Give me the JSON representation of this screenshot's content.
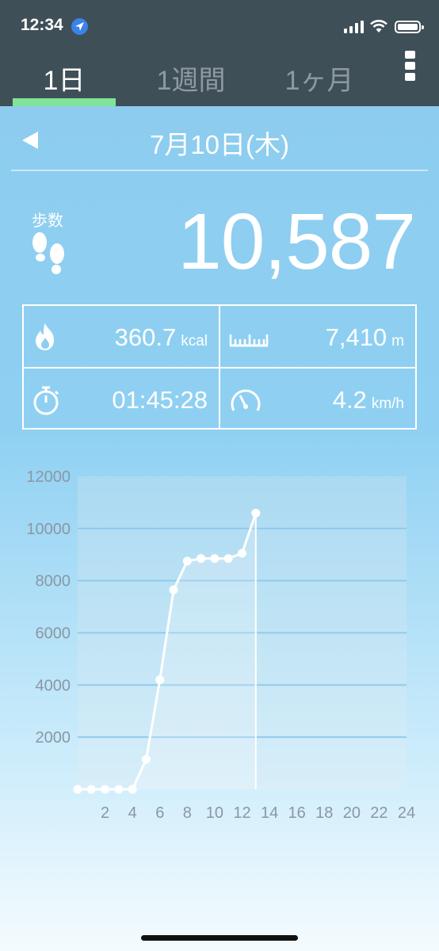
{
  "status_bar": {
    "time": "12:34"
  },
  "tabs": [
    {
      "label": "1日",
      "active": true
    },
    {
      "label": "1週間",
      "active": false
    },
    {
      "label": "1ヶ月",
      "active": false
    }
  ],
  "date": {
    "label": "7月10日(木)"
  },
  "steps": {
    "label": "歩数",
    "value": "10,587"
  },
  "stats": {
    "calories": {
      "value": "360.7",
      "unit": "kcal",
      "icon": "flame-icon"
    },
    "distance": {
      "value": "7,410",
      "unit": "m",
      "icon": "ruler-icon"
    },
    "duration": {
      "value": "01:45:28",
      "icon": "stopwatch-icon"
    },
    "speed": {
      "value": "4.2",
      "unit": "km/h",
      "icon": "speedometer-icon"
    }
  },
  "colors": {
    "header_bg": "#3f4f57",
    "tab_active_underline": "#7fe39a",
    "tab_inactive_text": "#8e9aa0",
    "axis_label": "#8a97a4"
  },
  "chart_data": {
    "type": "line",
    "x": [
      0,
      1,
      2,
      3,
      4,
      5,
      6,
      7,
      8,
      9,
      10,
      11,
      12,
      13
    ],
    "series": [
      {
        "values": [
          0,
          0,
          0,
          0,
          0,
          1150,
          4200,
          7650,
          8750,
          8850,
          8850,
          8850,
          9050,
          10587
        ]
      }
    ],
    "x_ticks": [
      "2",
      "4",
      "6",
      "8",
      "10",
      "12",
      "14",
      "16",
      "18",
      "20",
      "22",
      "24"
    ],
    "y_ticks": [
      "12000",
      "10000",
      "8000",
      "6000",
      "4000",
      "2000"
    ],
    "xlim": [
      0,
      24
    ],
    "ylim": [
      0,
      12000
    ],
    "grid": true
  }
}
